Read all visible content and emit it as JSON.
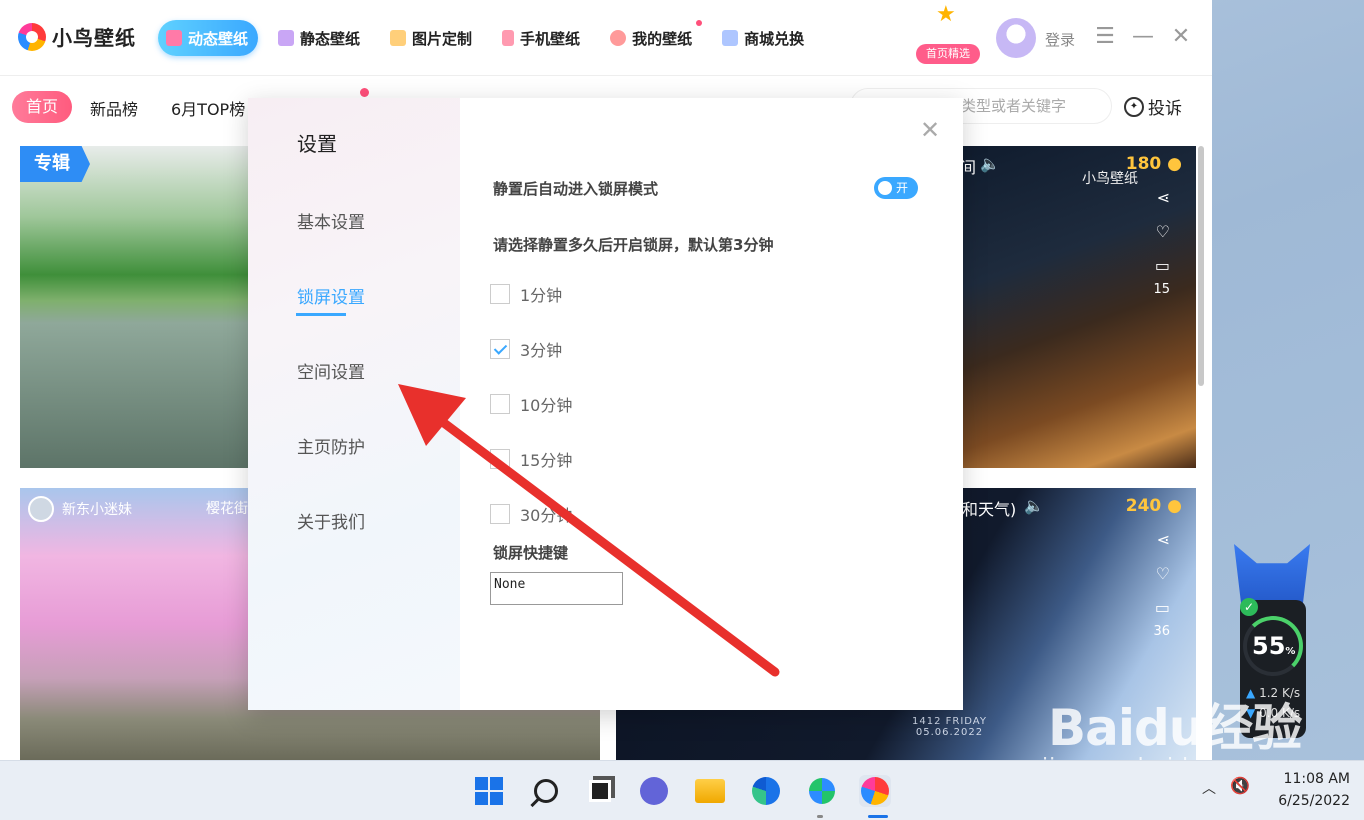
{
  "app": {
    "brand": "小鸟壁纸",
    "nav": [
      {
        "label": "动态壁纸",
        "active": true,
        "icon": "play-icon",
        "color": "#ffffff"
      },
      {
        "label": "静态壁纸",
        "active": false,
        "icon": "image-icon",
        "color": "#b98cf0"
      },
      {
        "label": "图片定制",
        "active": false,
        "icon": "diy-icon",
        "color": "#ffb84d"
      },
      {
        "label": "手机壁纸",
        "active": false,
        "icon": "phone-icon",
        "color": "#ff6b8b"
      },
      {
        "label": "我的壁纸",
        "active": false,
        "icon": "user-icon",
        "color": "#ff7a7a"
      },
      {
        "label": "商城兑换",
        "active": false,
        "icon": "shop-icon",
        "color": "#8fb2ff"
      }
    ],
    "mascot_tag": "首页精选",
    "login": "登录",
    "subnav": {
      "home": "首页",
      "new": "新品榜",
      "top": "6月TOP榜",
      "search_placeholder": "类型或者关键字",
      "complain": "投诉"
    },
    "cards": {
      "album_tag": "专辑",
      "card2": {
        "label_partial": "间",
        "price": "180",
        "watermark": "小鸟壁纸",
        "comments": "15"
      },
      "card3": {
        "user": "新东小迷妹",
        "title_partial": "樱花街"
      },
      "card4": {
        "label_partial": "和天气)",
        "price": "240",
        "comments": "36",
        "caption_line1": "1412 FRIDAY",
        "caption_line2": "05.06.2022"
      }
    }
  },
  "dialog": {
    "title": "设置",
    "menu": [
      "基本设置",
      "锁屏设置",
      "空间设置",
      "主页防护",
      "关于我们"
    ],
    "active_menu": "锁屏设置",
    "auto_lock_label": "静置后自动进入锁屏模式",
    "toggle_label": "开",
    "toggle_on": true,
    "idle_prompt": "请选择静置多久后开启锁屏，默认第3分钟",
    "options": [
      {
        "label": "1分钟",
        "checked": false
      },
      {
        "label": "3分钟",
        "checked": true
      },
      {
        "label": "10分钟",
        "checked": false
      },
      {
        "label": "15分钟",
        "checked": false
      },
      {
        "label": "30分钟",
        "checked": false
      }
    ],
    "shortcut_label": "锁屏快捷键",
    "shortcut_value": "None"
  },
  "speed_widget": {
    "percent": "55",
    "percent_unit": "%",
    "upload": "1.2 K/s",
    "download": "0.0 K/s"
  },
  "watermark": {
    "brand": "Baidu经验",
    "url": "jingyan.baidu.com"
  },
  "taskbar": {
    "time": "11:08 AM",
    "date": "6/25/2022"
  },
  "colors": {
    "accent": "#3aa8ff",
    "home_pill": "#ff5b7e",
    "arrow": "#e8302c"
  }
}
